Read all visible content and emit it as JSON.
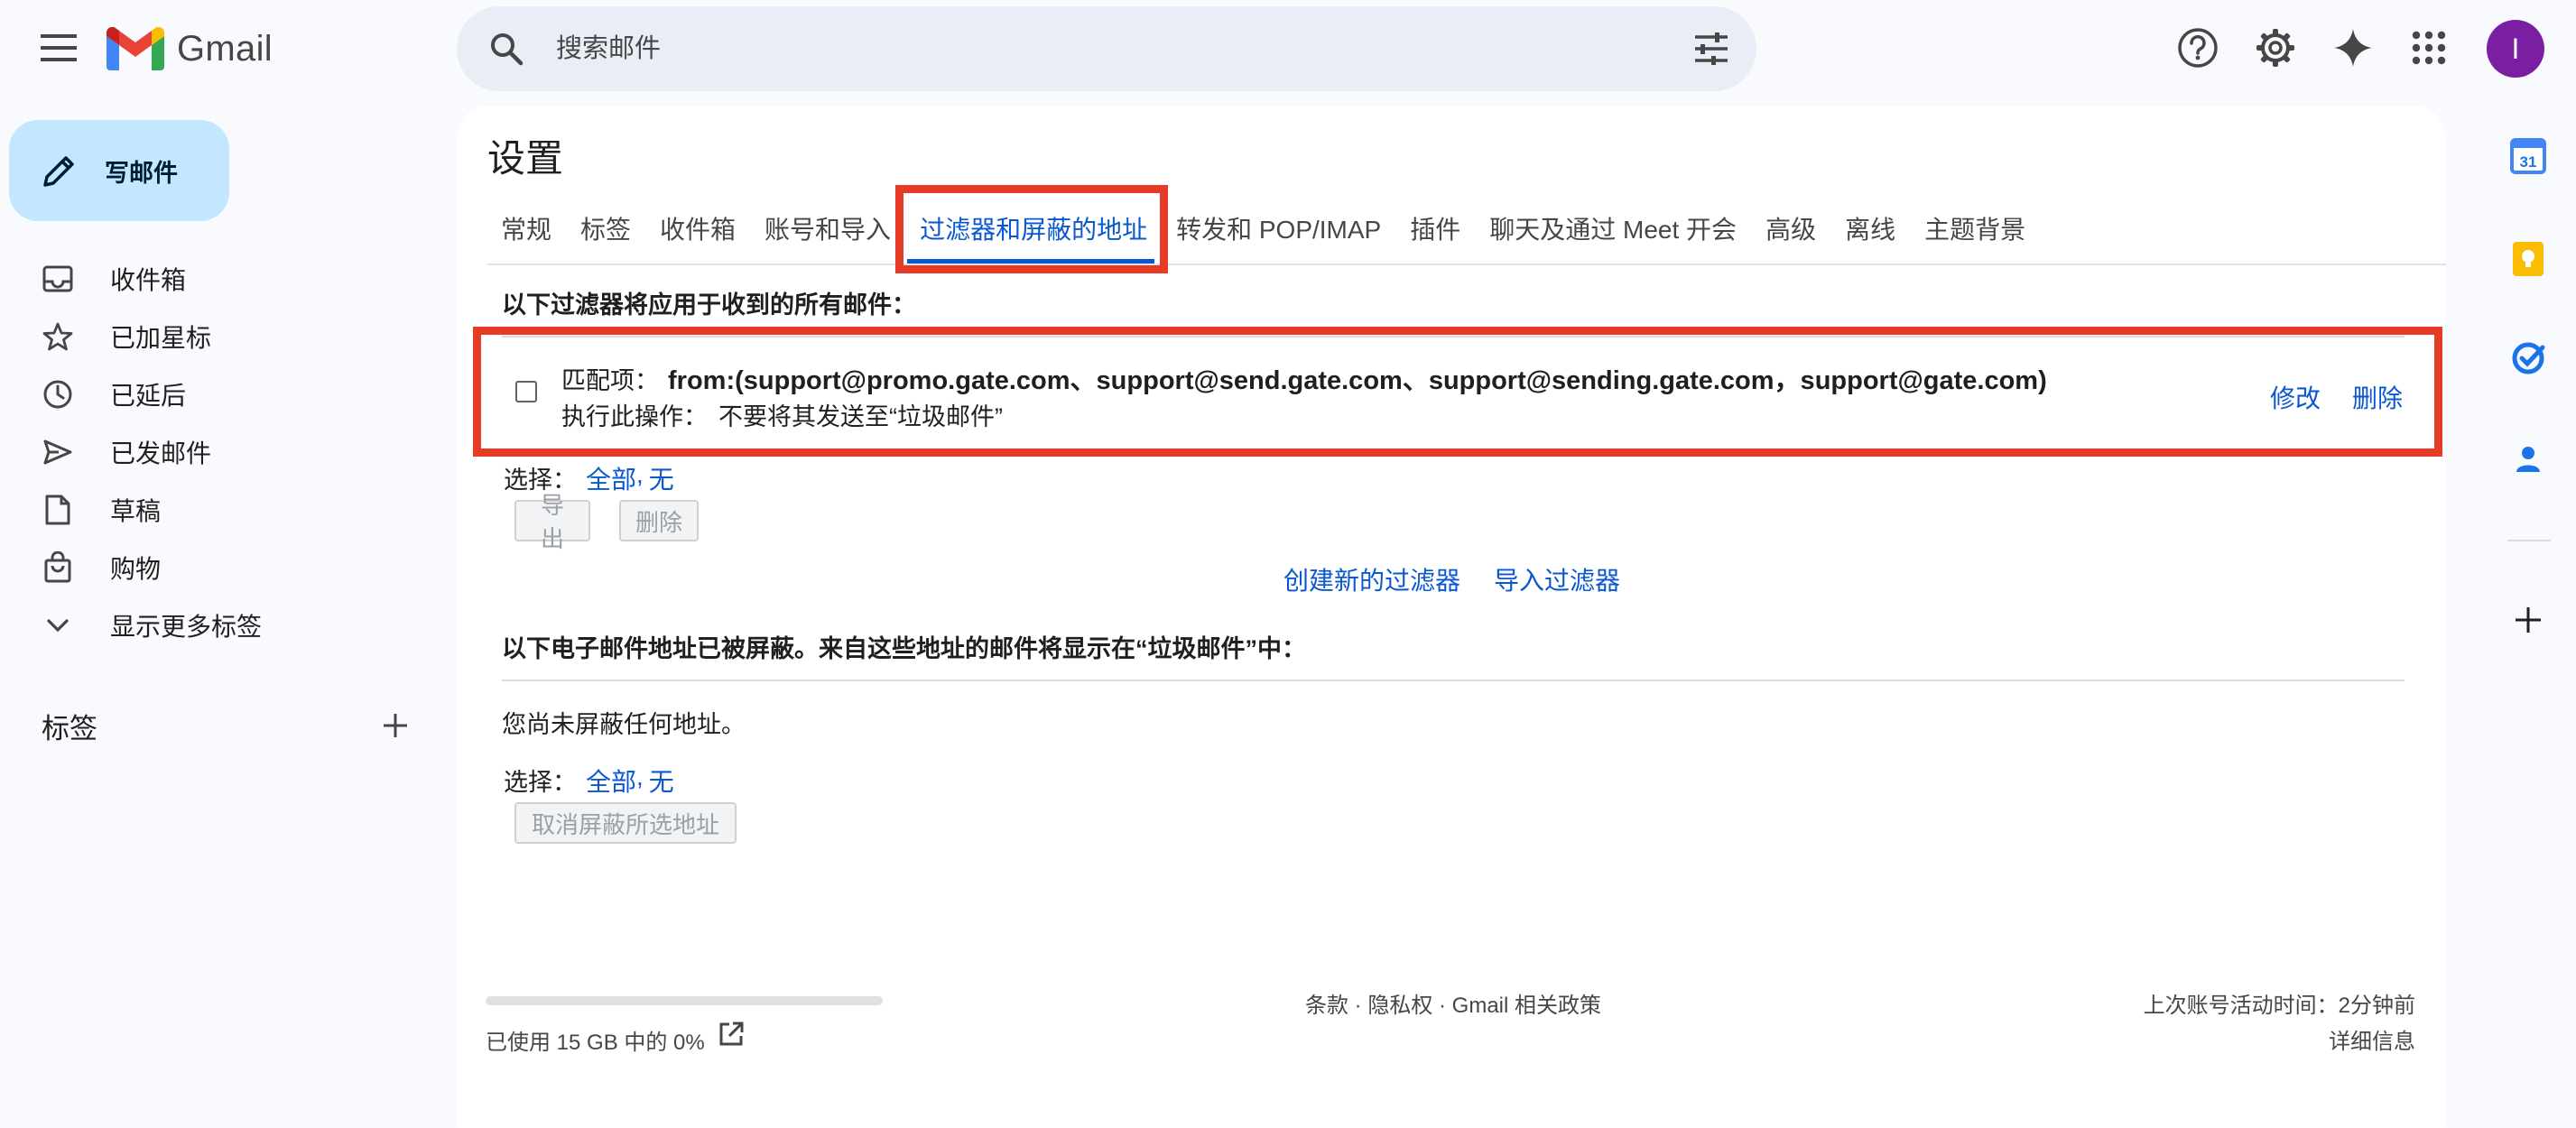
{
  "header": {
    "app_name": "Gmail",
    "search_placeholder": "搜索邮件",
    "avatar_letter": "I"
  },
  "sidebar": {
    "compose_label": "写邮件",
    "items": [
      {
        "label": "收件箱",
        "icon": "inbox-icon"
      },
      {
        "label": "已加星标",
        "icon": "star-icon"
      },
      {
        "label": "已延后",
        "icon": "clock-icon"
      },
      {
        "label": "已发邮件",
        "icon": "send-icon"
      },
      {
        "label": "草稿",
        "icon": "draft-icon"
      },
      {
        "label": "购物",
        "icon": "shopping-bag-icon"
      },
      {
        "label": "显示更多标签",
        "icon": "chevron-down-icon"
      }
    ],
    "labels_header": "标签"
  },
  "settings": {
    "title": "设置",
    "tabs": [
      {
        "label": "常规",
        "active": false
      },
      {
        "label": "标签",
        "active": false
      },
      {
        "label": "收件箱",
        "active": false
      },
      {
        "label": "账号和导入",
        "active": false
      },
      {
        "label": "过滤器和屏蔽的地址",
        "active": true
      },
      {
        "label": "转发和 POP/IMAP",
        "active": false
      },
      {
        "label": "插件",
        "active": false
      },
      {
        "label": "聊天及通过 Meet 开会",
        "active": false
      },
      {
        "label": "高级",
        "active": false
      },
      {
        "label": "离线",
        "active": false
      },
      {
        "label": "主题背景",
        "active": false
      }
    ],
    "filters": {
      "section_title": "以下过滤器将应用于收到的所有邮件：",
      "rows": [
        {
          "match_label": "匹配项：",
          "match_value": "from:(support@promo.gate.com、support@send.gate.com、support@sending.gate.com，support@gate.com)",
          "action_label": "执行此操作：",
          "action_value": "不要将其发送至“垃圾邮件”",
          "edit_label": "修改",
          "delete_label": "删除"
        }
      ],
      "select_label": "选择：",
      "select_all": "全部",
      "select_sep": ",",
      "select_none": "无",
      "export_button": "导出",
      "delete_button": "删除",
      "create_filter": "创建新的过滤器",
      "import_filter": "导入过滤器"
    },
    "blocked": {
      "section_title": "以下电子邮件地址已被屏蔽。来自这些地址的邮件将显示在“垃圾邮件”中：",
      "empty_text": "您尚未屏蔽任何地址。",
      "select_label": "选择：",
      "select_all": "全部",
      "select_sep": ",",
      "select_none": "无",
      "unblock_button": "取消屏蔽所选地址"
    }
  },
  "footer": {
    "storage_text": "已使用 15 GB 中的 0%",
    "storage_fraction": 0,
    "policy_text": "条款 · 隐私权 · Gmail 相关政策",
    "activity_text": "上次账号活动时间：2分钟前",
    "details_link": "详细信息"
  },
  "right_panel": {
    "calendar_day": "31"
  },
  "colors": {
    "accent": "#0b57d0",
    "highlight_box": "#e63b26",
    "compose_bg": "#c2e7ff",
    "avatar_bg": "#7b1fa2"
  }
}
